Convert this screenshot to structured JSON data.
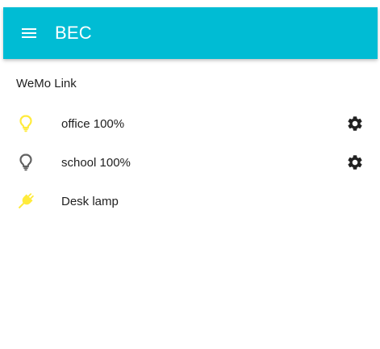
{
  "app": {
    "title": "BEC",
    "menu_icon": "menu-icon",
    "appbar_color": "#00BCD4"
  },
  "section": {
    "title": "WeMo Link"
  },
  "devices": [
    {
      "label": "office 100%",
      "icon": "lightbulb-on-icon",
      "icon_color": "#FFEB3B",
      "has_settings": true,
      "settings_icon": "gear-icon"
    },
    {
      "label": "school 100%",
      "icon": "lightbulb-off-icon",
      "icon_color": "#616161",
      "has_settings": true,
      "settings_icon": "gear-icon"
    },
    {
      "label": "Desk lamp",
      "icon": "power-plug-icon",
      "icon_color": "#FFEB3B",
      "has_settings": false
    }
  ]
}
